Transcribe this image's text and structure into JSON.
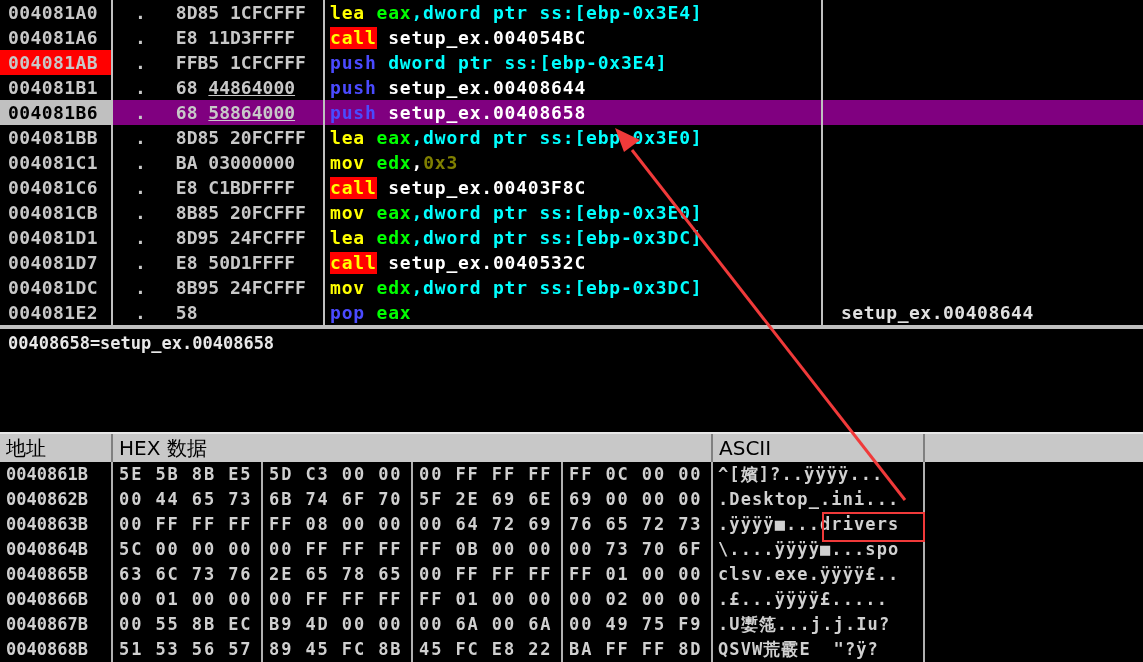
{
  "disassembly": {
    "rows": [
      {
        "address": "004081A0",
        "marker": ".",
        "hex": [
          {
            "text": "8D85 1CFCFFF",
            "underlined": false
          }
        ],
        "mnemonic": {
          "text": "lea",
          "kind": "op"
        },
        "operands": [
          {
            "text": " eax",
            "kind": "reg"
          },
          {
            "text": ",dword ptr ss:[ebp-0x3E4]",
            "kind": "mem"
          }
        ],
        "comment": "",
        "selected": false,
        "breakpoint": false
      },
      {
        "address": "004081A6",
        "marker": ".",
        "hex": [
          {
            "text": "E8 11D3FFFF",
            "underlined": false
          }
        ],
        "mnemonic": {
          "text": "call",
          "kind": "call"
        },
        "operands": [
          {
            "text": " setup_ex.004054BC",
            "kind": "plain"
          }
        ],
        "comment": "",
        "selected": false,
        "breakpoint": false
      },
      {
        "address": "004081AB",
        "marker": ".",
        "hex": [
          {
            "text": "FFB5 1CFCFFF",
            "underlined": false
          }
        ],
        "mnemonic": {
          "text": "push",
          "kind": "stack"
        },
        "operands": [
          {
            "text": " dword ptr ss:[ebp-0x3E4]",
            "kind": "mem"
          }
        ],
        "comment": "",
        "selected": false,
        "breakpoint": true
      },
      {
        "address": "004081B1",
        "marker": ".",
        "hex": [
          {
            "text": "68 ",
            "underlined": false
          },
          {
            "text": "44864000",
            "underlined": true
          }
        ],
        "mnemonic": {
          "text": "push",
          "kind": "stack"
        },
        "operands": [
          {
            "text": " setup_ex.00408644",
            "kind": "plain"
          }
        ],
        "comment": "",
        "selected": false,
        "breakpoint": false
      },
      {
        "address": "004081B6",
        "marker": ".",
        "hex": [
          {
            "text": "68 ",
            "underlined": false
          },
          {
            "text": "58864000",
            "underlined": true
          }
        ],
        "mnemonic": {
          "text": "push",
          "kind": "stack"
        },
        "operands": [
          {
            "text": " setup_ex.00408658",
            "kind": "plain"
          }
        ],
        "comment": "",
        "selected": true,
        "breakpoint": false
      },
      {
        "address": "004081BB",
        "marker": ".",
        "hex": [
          {
            "text": "8D85 20FCFFF",
            "underlined": false
          }
        ],
        "mnemonic": {
          "text": "lea",
          "kind": "op"
        },
        "operands": [
          {
            "text": " eax",
            "kind": "reg"
          },
          {
            "text": ",dword ptr ss:[ebp-0x3E0]",
            "kind": "mem"
          }
        ],
        "comment": "",
        "selected": false,
        "breakpoint": false
      },
      {
        "address": "004081C1",
        "marker": ".",
        "hex": [
          {
            "text": "BA 03000000",
            "underlined": false
          }
        ],
        "mnemonic": {
          "text": "mov",
          "kind": "op"
        },
        "operands": [
          {
            "text": " edx",
            "kind": "reg"
          },
          {
            "text": ",",
            "kind": "plain"
          },
          {
            "text": "0x3",
            "kind": "imm"
          }
        ],
        "comment": "",
        "selected": false,
        "breakpoint": false
      },
      {
        "address": "004081C6",
        "marker": ".",
        "hex": [
          {
            "text": "E8 C1BDFFFF",
            "underlined": false
          }
        ],
        "mnemonic": {
          "text": "call",
          "kind": "call"
        },
        "operands": [
          {
            "text": " setup_ex.00403F8C",
            "kind": "plain"
          }
        ],
        "comment": "",
        "selected": false,
        "breakpoint": false
      },
      {
        "address": "004081CB",
        "marker": ".",
        "hex": [
          {
            "text": "8B85 20FCFFF",
            "underlined": false
          }
        ],
        "mnemonic": {
          "text": "mov",
          "kind": "op"
        },
        "operands": [
          {
            "text": " eax",
            "kind": "reg"
          },
          {
            "text": ",dword ptr ss:[ebp-0x3E0]",
            "kind": "mem"
          }
        ],
        "comment": "",
        "selected": false,
        "breakpoint": false
      },
      {
        "address": "004081D1",
        "marker": ".",
        "hex": [
          {
            "text": "8D95 24FCFFF",
            "underlined": false
          }
        ],
        "mnemonic": {
          "text": "lea",
          "kind": "op"
        },
        "operands": [
          {
            "text": " edx",
            "kind": "reg"
          },
          {
            "text": ",dword ptr ss:[ebp-0x3DC]",
            "kind": "mem"
          }
        ],
        "comment": "",
        "selected": false,
        "breakpoint": false
      },
      {
        "address": "004081D7",
        "marker": ".",
        "hex": [
          {
            "text": "E8 50D1FFFF",
            "underlined": false
          }
        ],
        "mnemonic": {
          "text": "call",
          "kind": "call"
        },
        "operands": [
          {
            "text": " setup_ex.0040532C",
            "kind": "plain"
          }
        ],
        "comment": "",
        "selected": false,
        "breakpoint": false
      },
      {
        "address": "004081DC",
        "marker": ".",
        "hex": [
          {
            "text": "8B95 24FCFFF",
            "underlined": false
          }
        ],
        "mnemonic": {
          "text": "mov",
          "kind": "op"
        },
        "operands": [
          {
            "text": " edx",
            "kind": "reg"
          },
          {
            "text": ",dword ptr ss:[ebp-0x3DC]",
            "kind": "mem"
          }
        ],
        "comment": "",
        "selected": false,
        "breakpoint": false
      },
      {
        "address": "004081E2",
        "marker": ".",
        "hex": [
          {
            "text": "58",
            "underlined": false
          }
        ],
        "mnemonic": {
          "text": "pop",
          "kind": "stack"
        },
        "operands": [
          {
            "text": " eax",
            "kind": "reg"
          }
        ],
        "comment": "setup_ex.00408644",
        "selected": false,
        "breakpoint": false
      }
    ]
  },
  "info_pane": {
    "text": "00408658=setup_ex.00408658"
  },
  "dump": {
    "columns": [
      "地址",
      "HEX 数据",
      "ASCII"
    ],
    "rows": [
      {
        "address": "0040861B",
        "bytes": [
          "5E 5B 8B E5",
          "5D C3 00 00",
          "00 FF FF FF",
          "FF 0C 00 00"
        ],
        "ascii": "^[嬪]?..ÿÿÿÿ..."
      },
      {
        "address": "0040862B",
        "bytes": [
          "00 44 65 73",
          "6B 74 6F 70",
          "5F 2E 69 6E",
          "69 00 00 00"
        ],
        "ascii": ".Desktop_.ini..."
      },
      {
        "address": "0040863B",
        "bytes": [
          "00 FF FF FF",
          "FF 08 00 00",
          "00 64 72 69",
          "76 65 72 73"
        ],
        "ascii": ".ÿÿÿÿ■...drivers"
      },
      {
        "address": "0040864B",
        "bytes": [
          "5C 00 00 00",
          "00 FF FF FF",
          "FF 0B 00 00",
          "00 73 70 6F"
        ],
        "ascii": "\\....ÿÿÿÿ■...spo"
      },
      {
        "address": "0040865B",
        "bytes": [
          "63 6C 73 76",
          "2E 65 78 65",
          "00 FF FF FF",
          "FF 01 00 00"
        ],
        "ascii": "clsv.exe.ÿÿÿÿ£.."
      },
      {
        "address": "0040866B",
        "bytes": [
          "00 01 00 00",
          "00 FF FF FF",
          "FF 01 00 00",
          "00 02 00 00"
        ],
        "ascii": ".£...ÿÿÿÿ£....."
      },
      {
        "address": "0040867B",
        "bytes": [
          "00 55 8B EC",
          "B9 4D 00 00",
          "00 6A 00 6A",
          "00 49 75 F9"
        ],
        "ascii": ".U嬱筂...j.j.Iu?"
      },
      {
        "address": "0040868B",
        "bytes": [
          "51 53 56 57",
          "89 45 FC 8B",
          "45 FC E8 22",
          "BA FF FF 8D"
        ],
        "ascii": "QSVW荒霰E  \"?ÿ?"
      }
    ]
  }
}
